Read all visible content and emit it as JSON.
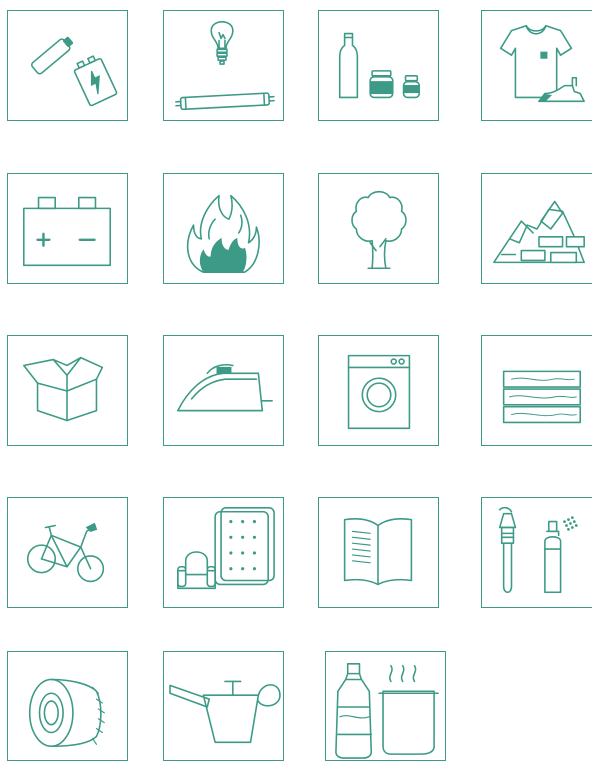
{
  "colors": {
    "accent": "#3c9a86",
    "background": "#ffffff"
  },
  "tiles": [
    {
      "icon": "batteries-icon"
    },
    {
      "icon": "light-bulb-and-fluorescent-tube-icon"
    },
    {
      "icon": "glass-bottles-and-jars-icon"
    },
    {
      "icon": "clothes-and-shoes-icon"
    },
    {
      "icon": "car-battery-icon"
    },
    {
      "icon": "fire-icon"
    },
    {
      "icon": "tree-icon"
    },
    {
      "icon": "construction-rubble-icon"
    },
    {
      "icon": "cardboard-box-icon"
    },
    {
      "icon": "clothes-iron-icon"
    },
    {
      "icon": "washing-machine-icon"
    },
    {
      "icon": "wood-planks-icon"
    },
    {
      "icon": "bicycle-icon"
    },
    {
      "icon": "furniture-and-mattress-icon"
    },
    {
      "icon": "book-icon"
    },
    {
      "icon": "paint-brush-and-spray-can-icon"
    },
    {
      "icon": "tire-icon"
    },
    {
      "icon": "oil-can-icon"
    },
    {
      "icon": "oil-bottle-and-pot-icon"
    }
  ]
}
